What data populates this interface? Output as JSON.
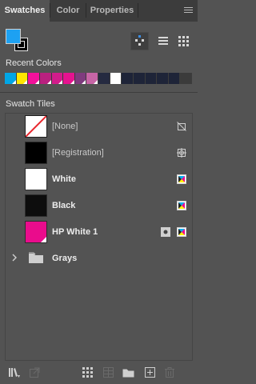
{
  "tabs": [
    {
      "label": "Swatches",
      "active": true
    },
    {
      "label": "Color",
      "active": false
    },
    {
      "label": "Properties",
      "active": false
    }
  ],
  "fill_color": "#1da1f2",
  "stroke_color": "#000000",
  "recent_colors": {
    "label": "Recent Colors",
    "swatches": [
      "#00a6e6",
      "#ffe600",
      "#f3119b",
      "#b9207f",
      "#d21c8b",
      "#e6128f",
      "#7f3b7e",
      "#c765a6",
      "#252a40",
      "#ffffff",
      "#1e2438",
      "#1e2438",
      "#1e2438",
      "#1e2438",
      "#1e2438",
      "#3b3b3b"
    ]
  },
  "swatch_tiles": {
    "label": "Swatch Tiles",
    "rows": [
      {
        "name": "[None]",
        "color": "#ffffff",
        "style": "dim",
        "icon": "no-print-icon"
      },
      {
        "name": "[Registration]",
        "color": "#000000",
        "style": "dim",
        "icon": "registration-target-icon"
      },
      {
        "name": "White",
        "color": "#ffffff",
        "style": "bold",
        "icon": "process-color-icon"
      },
      {
        "name": "Black",
        "color": "#0d0d0d",
        "style": "bold",
        "icon": "process-color-icon"
      },
      {
        "name": "HP White 1",
        "color": "#ea0c8c",
        "style": "bold",
        "icon": "process-color-icon"
      },
      {
        "name": "Grays",
        "style": "bold",
        "type": "folder"
      }
    ]
  },
  "bottom_toolbar": {
    "icons": [
      "swatch-libraries-menu-icon",
      "place-swatches-icon",
      "show-swatch-kinds-icon",
      "swatch-options-icon",
      "new-color-group-icon",
      "new-swatch-icon",
      "delete-swatch-icon"
    ]
  }
}
